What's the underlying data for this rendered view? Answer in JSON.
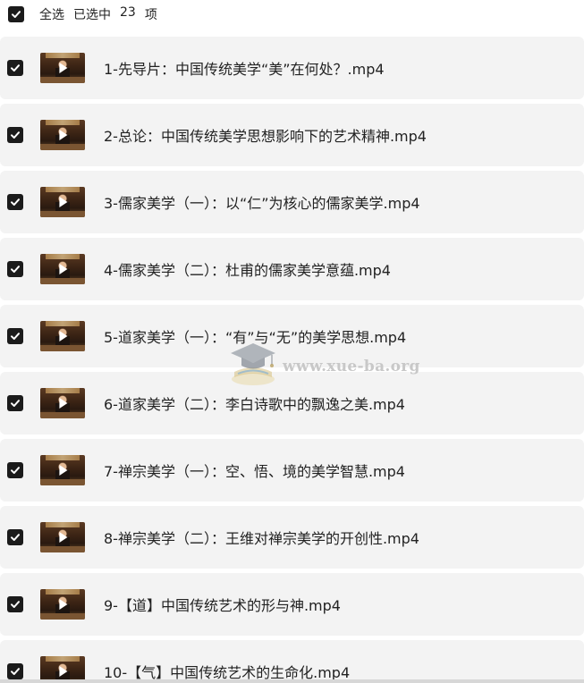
{
  "header": {
    "select_all_label": "全选",
    "selected_prefix": "已选中",
    "selected_count": "23",
    "selected_suffix": "项",
    "all_checked": true
  },
  "files": [
    {
      "name": "1-先导片：中国传统美学“美”在何处？.mp4",
      "checked": true
    },
    {
      "name": "2-总论：中国传统美学思想影响下的艺术精神.mp4",
      "checked": true
    },
    {
      "name": "3-儒家美学（一）：以“仁”为核心的儒家美学.mp4",
      "checked": true
    },
    {
      "name": "4-儒家美学（二）：杜甫的儒家美学意蕴.mp4",
      "checked": true
    },
    {
      "name": "5-道家美学（一）：“有”与“无”的美学思想.mp4",
      "checked": true
    },
    {
      "name": "6-道家美学（二）：李白诗歌中的飘逸之美.mp4",
      "checked": true
    },
    {
      "name": "7-禅宗美学（一）：空、悟、境的美学智慧.mp4",
      "checked": true
    },
    {
      "name": "8-禅宗美学（二）：王维对禅宗美学的开创性.mp4",
      "checked": true
    },
    {
      "name": "9-【道】中国传统艺术的形与神.mp4",
      "checked": true
    },
    {
      "name": "10-【气】中国传统艺术的生命化.mp4",
      "checked": true
    }
  ],
  "watermark": {
    "text": "www.xue-ba.org"
  },
  "colors": {
    "checkbox": "#1b1b1b",
    "row_background": "#f3f3f3",
    "text": "#222222"
  }
}
